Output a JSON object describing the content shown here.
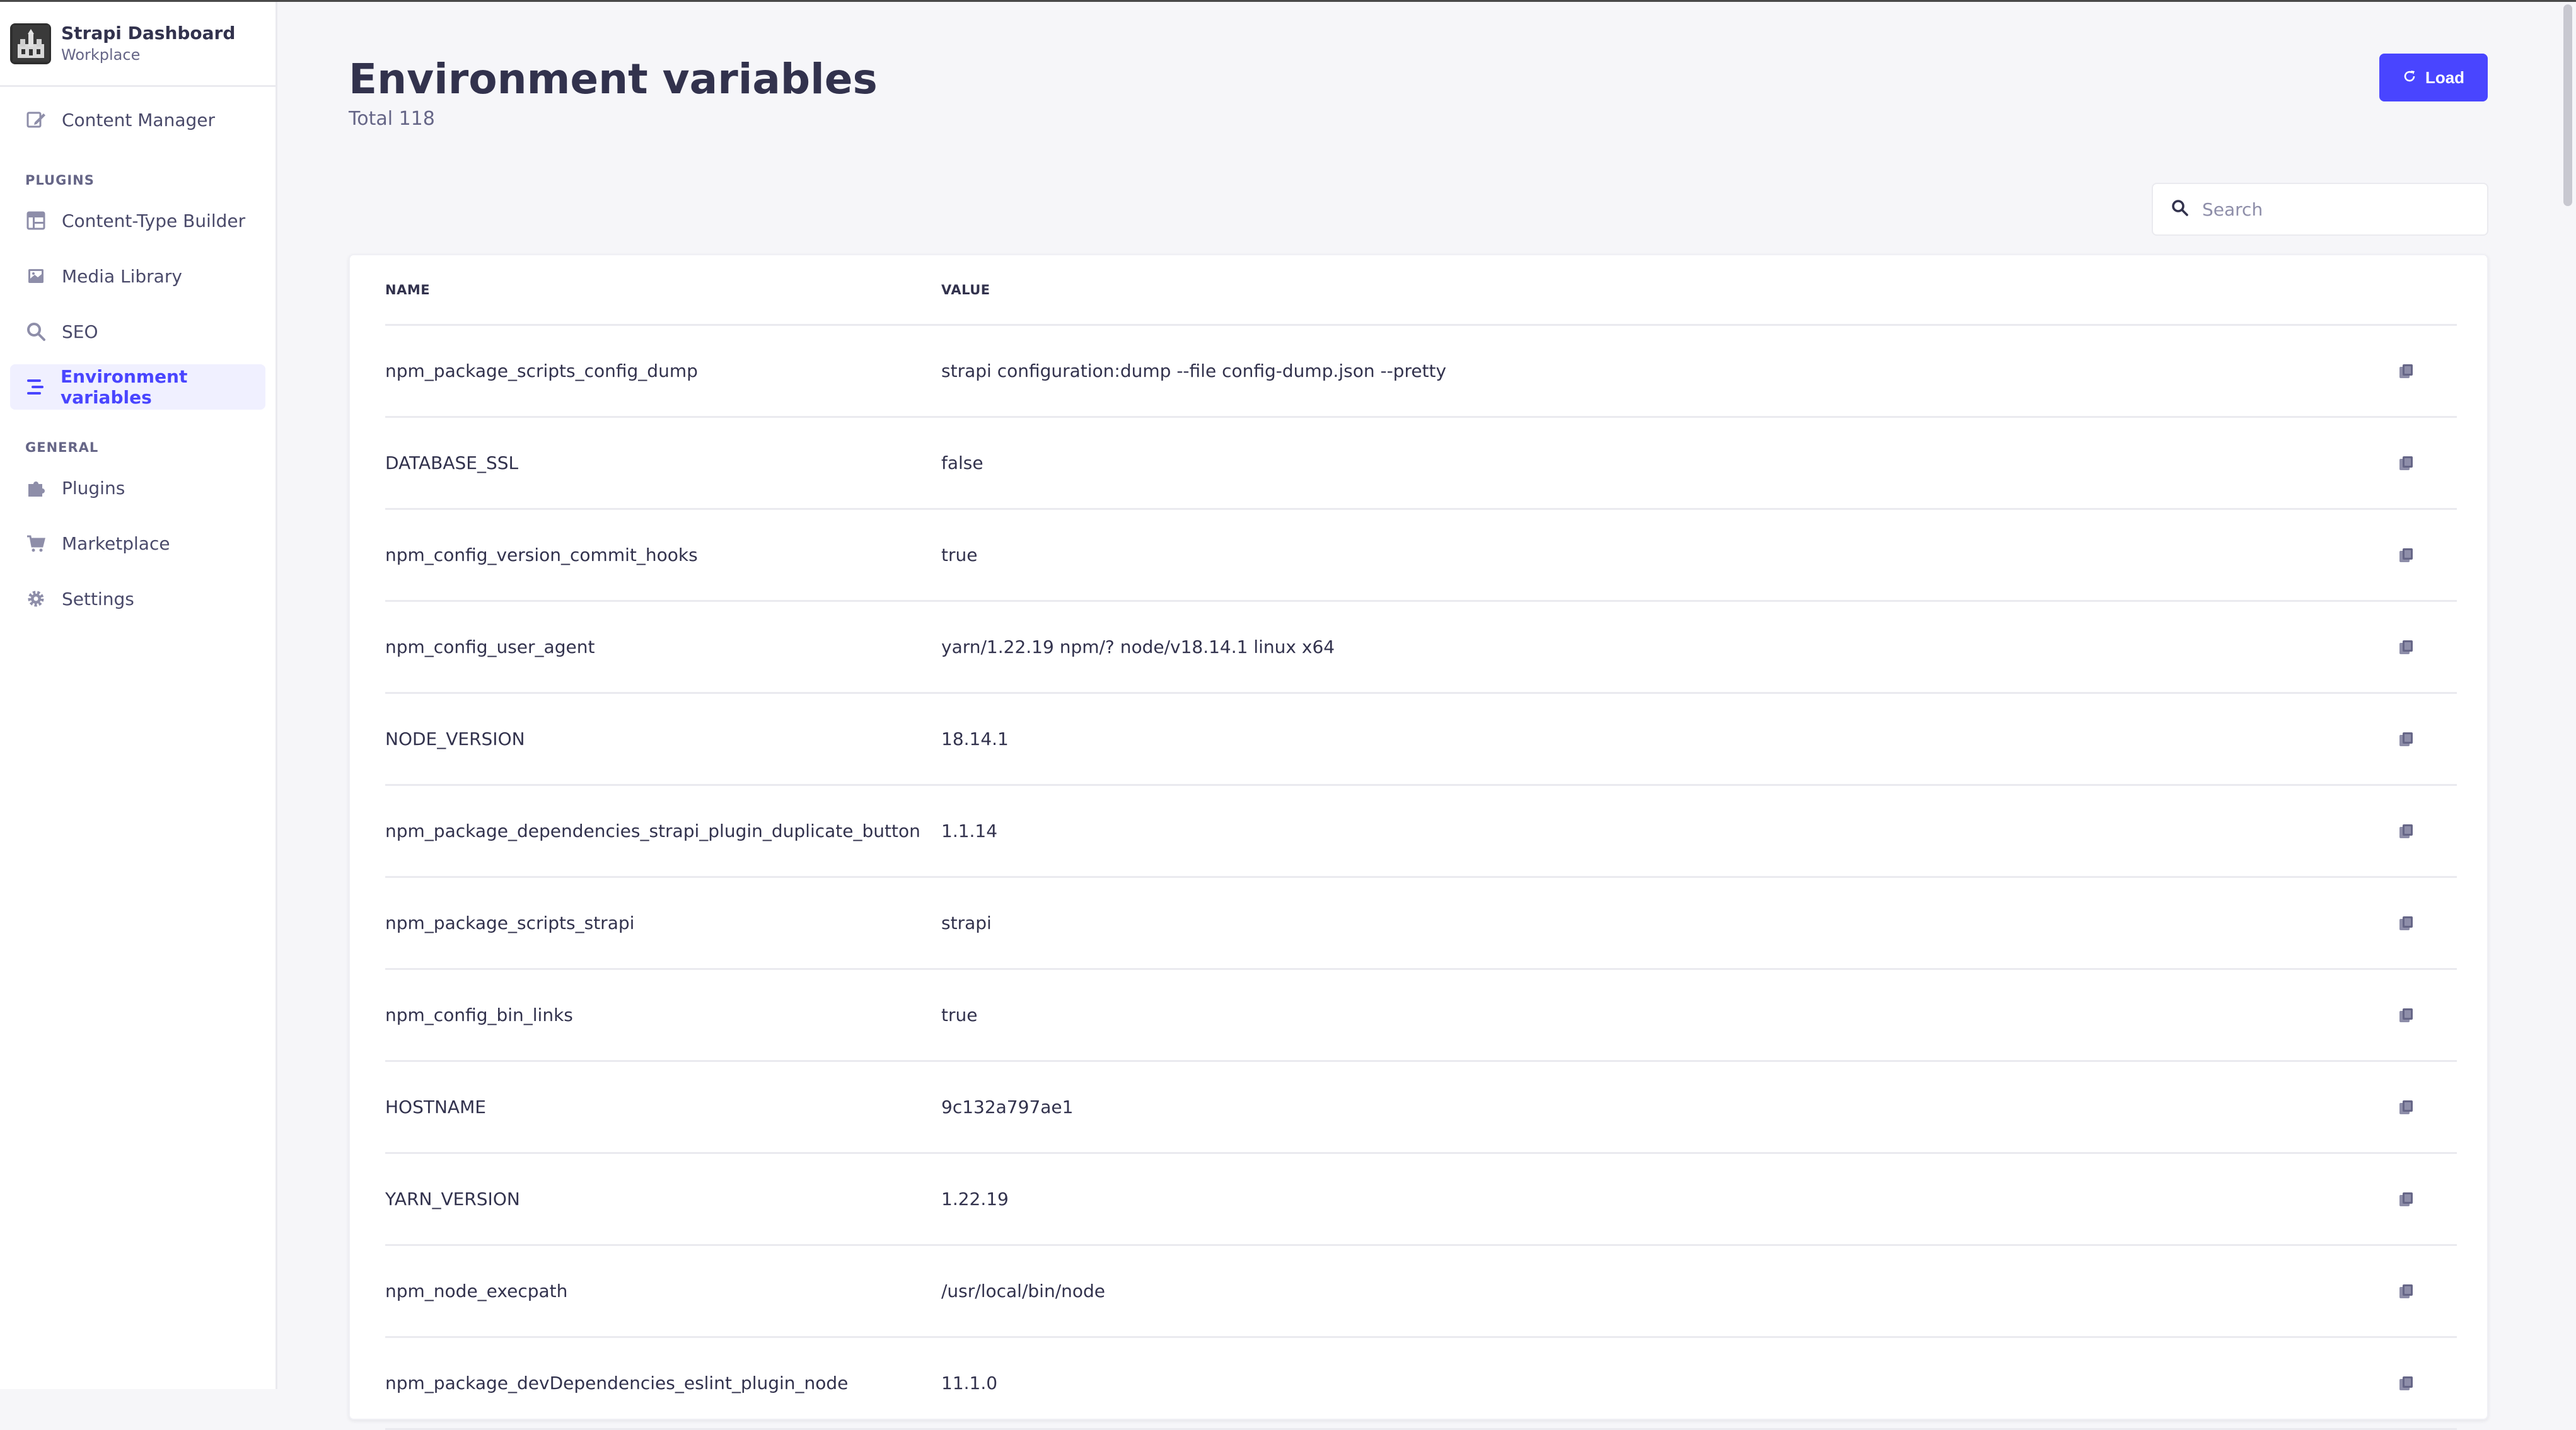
{
  "brand": {
    "title": "Strapi Dashboard",
    "subtitle": "Workplace"
  },
  "sidebar": {
    "top_items": [
      {
        "label": "Content Manager",
        "icon": "pencil-icon"
      }
    ],
    "plugins_heading": "PLUGINS",
    "plugin_items": [
      {
        "label": "Content-Type Builder",
        "icon": "layout-icon"
      },
      {
        "label": "Media Library",
        "icon": "image-icon"
      },
      {
        "label": "SEO",
        "icon": "search-icon"
      },
      {
        "label": "Environment variables",
        "icon": "list-icon",
        "active": true
      }
    ],
    "general_heading": "GENERAL",
    "general_items": [
      {
        "label": "Plugins",
        "icon": "puzzle-icon"
      },
      {
        "label": "Marketplace",
        "icon": "cart-icon"
      },
      {
        "label": "Settings",
        "icon": "gear-icon"
      }
    ]
  },
  "header": {
    "title": "Environment variables",
    "subtitle": "Total 118",
    "load_label": "Load"
  },
  "search": {
    "placeholder": "Search",
    "value": ""
  },
  "table": {
    "columns": [
      "NAME",
      "VALUE"
    ],
    "rows": [
      {
        "name": "npm_package_scripts_config_dump",
        "value": "strapi configuration:dump --file config-dump.json --pretty"
      },
      {
        "name": "DATABASE_SSL",
        "value": "false"
      },
      {
        "name": "npm_config_version_commit_hooks",
        "value": "true"
      },
      {
        "name": "npm_config_user_agent",
        "value": "yarn/1.22.19 npm/? node/v18.14.1 linux x64"
      },
      {
        "name": "NODE_VERSION",
        "value": "18.14.1"
      },
      {
        "name": "npm_package_dependencies_strapi_plugin_duplicate_button",
        "value": "1.1.14"
      },
      {
        "name": "npm_package_scripts_strapi",
        "value": "strapi"
      },
      {
        "name": "npm_config_bin_links",
        "value": "true"
      },
      {
        "name": "HOSTNAME",
        "value": "9c132a797ae1"
      },
      {
        "name": "YARN_VERSION",
        "value": "1.22.19"
      },
      {
        "name": "npm_node_execpath",
        "value": "/usr/local/bin/node"
      },
      {
        "name": "npm_package_devDependencies_eslint_plugin_node",
        "value": "11.1.0"
      }
    ]
  },
  "colors": {
    "accent": "#4945ff",
    "active_bg": "#f0f0ff",
    "text": "#32324d",
    "muted": "#666687",
    "icon": "#8e8ea9"
  }
}
